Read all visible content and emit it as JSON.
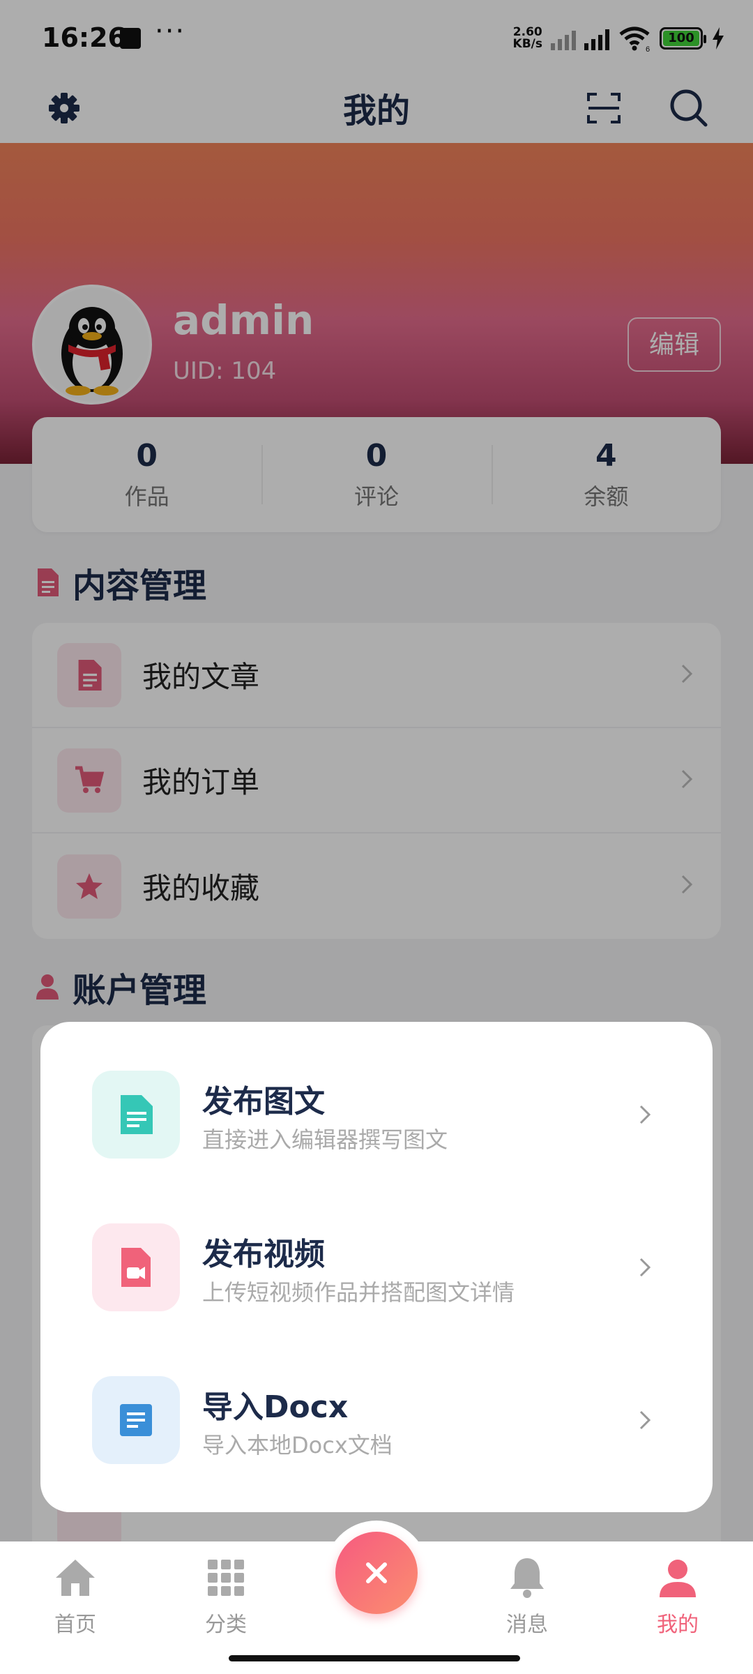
{
  "status_bar": {
    "time": "16:26",
    "network_speed_value": "2.60",
    "network_speed_unit": "KB/s",
    "battery": "100",
    "wifi_label": "6"
  },
  "header": {
    "title": "我的",
    "icons": [
      "gear-icon",
      "scan-icon",
      "search-icon"
    ]
  },
  "profile": {
    "username": "admin",
    "uid": "UID: 104",
    "edit_label": "编辑"
  },
  "stats": [
    {
      "value": "0",
      "label": "作品"
    },
    {
      "value": "0",
      "label": "评论"
    },
    {
      "value": "4",
      "label": "余额"
    }
  ],
  "content_section": {
    "title": "内容管理",
    "items": [
      {
        "label": "我的文章",
        "icon": "document-icon"
      },
      {
        "label": "我的订单",
        "icon": "cart-icon"
      },
      {
        "label": "我的收藏",
        "icon": "star-icon"
      }
    ]
  },
  "account_section": {
    "title": "账户管理"
  },
  "publish_popup": {
    "items": [
      {
        "title": "发布图文",
        "desc": "直接进入编辑器撰写图文",
        "icon": "document-icon",
        "color": "#35c7b6"
      },
      {
        "title": "发布视频",
        "desc": "上传短视频作品并搭配图文详情",
        "icon": "video-file-icon",
        "color": "#f0627a"
      },
      {
        "title": "导入Docx",
        "desc": "导入本地Docx文档",
        "icon": "docx-icon",
        "color": "#3a8fd8"
      }
    ]
  },
  "bottom_nav": {
    "items": [
      {
        "label": "首页",
        "icon": "home-icon"
      },
      {
        "label": "分类",
        "icon": "grid-icon"
      },
      {
        "label": "消息",
        "icon": "bell-icon"
      },
      {
        "label": "我的",
        "icon": "person-icon"
      }
    ],
    "active": "我的",
    "fab_icon": "close-icon"
  },
  "colors": {
    "accent": "#f0627a",
    "title_text": "#1d2b4a"
  }
}
